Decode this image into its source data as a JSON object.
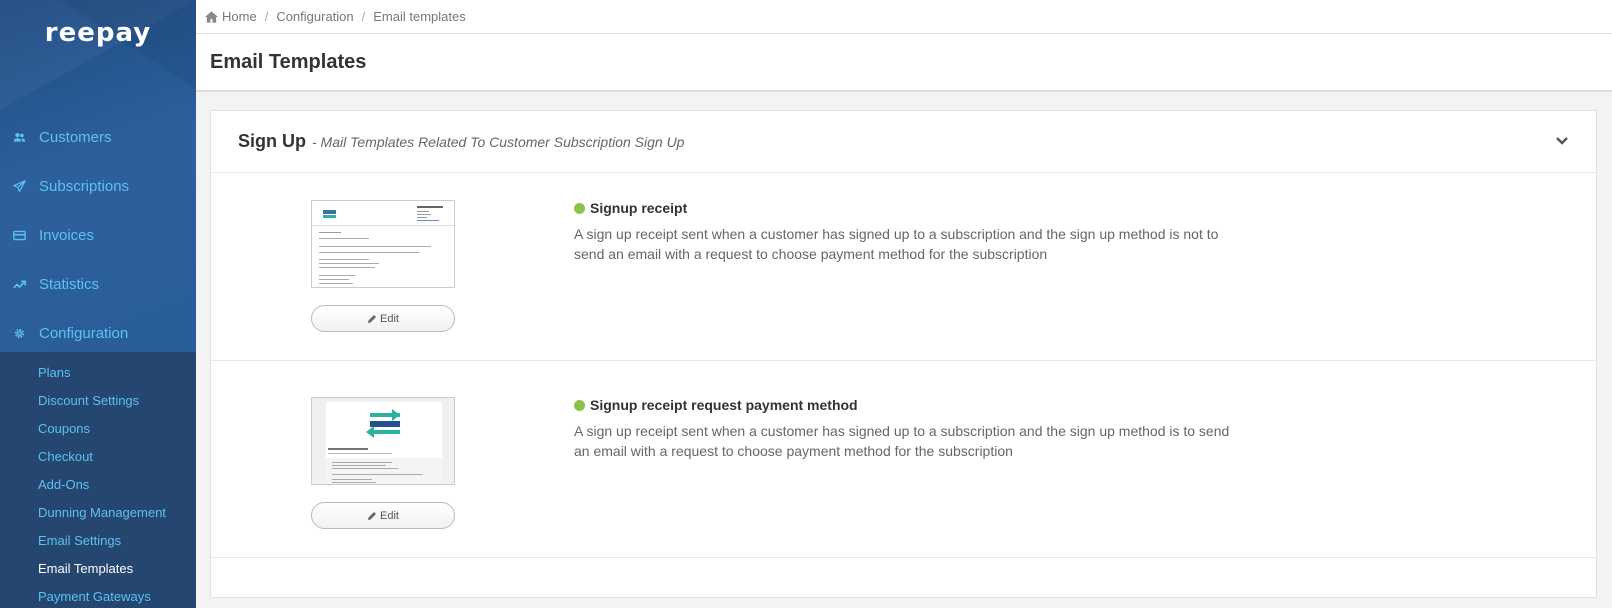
{
  "app": {
    "logo": "reepay"
  },
  "sidebar": {
    "main_items": [
      {
        "label": "Customers",
        "icon": "users-icon"
      },
      {
        "label": "Subscriptions",
        "icon": "paper-plane-icon"
      },
      {
        "label": "Invoices",
        "icon": "credit-card-icon"
      },
      {
        "label": "Statistics",
        "icon": "trend-icon"
      },
      {
        "label": "Configuration",
        "icon": "gear-icon"
      }
    ],
    "sub_items": [
      {
        "label": "Plans"
      },
      {
        "label": "Discount Settings"
      },
      {
        "label": "Coupons"
      },
      {
        "label": "Checkout"
      },
      {
        "label": "Add-Ons"
      },
      {
        "label": "Dunning Management"
      },
      {
        "label": "Email Settings"
      },
      {
        "label": "Email Templates",
        "active": true
      },
      {
        "label": "Payment Gateways"
      }
    ]
  },
  "breadcrumb": {
    "home": "Home",
    "level1": "Configuration",
    "level2": "Email templates"
  },
  "page": {
    "title": "Email Templates"
  },
  "section": {
    "title": "Sign Up",
    "subtitle": "- Mail Templates Related To Customer Subscription Sign Up"
  },
  "templates": [
    {
      "name": "Signup receipt",
      "description": "A sign up receipt sent when a customer has signed up to a subscription and the sign up method is not to send an email with a request to choose payment method for the subscription",
      "edit_label": "Edit",
      "status_color": "#8bc34a"
    },
    {
      "name": "Signup receipt request payment method",
      "description": "A sign up receipt sent when a customer has signed up to a subscription and the sign up method is to send an email with a request to choose payment method for the subscription",
      "edit_label": "Edit",
      "status_color": "#8bc34a"
    }
  ],
  "colors": {
    "sidebar": "#2a5a93",
    "sidebar_sub": "#24466f",
    "link": "#5cc2f2",
    "status_active": "#8bc34a"
  }
}
